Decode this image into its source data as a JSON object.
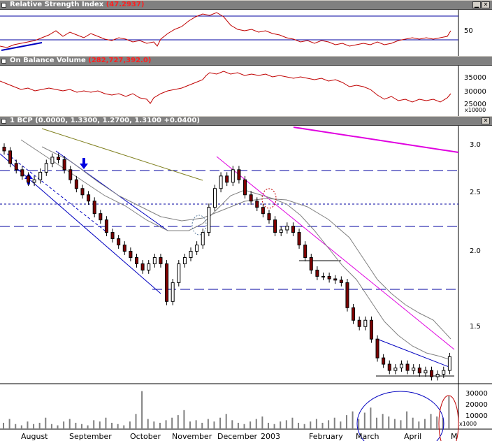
{
  "rsi": {
    "label": "Relative Strength Index",
    "value": "(47.2937)",
    "tick": "50"
  },
  "obv": {
    "label": "On Balance Volume",
    "value": "(282,727,392.0)",
    "ticks": [
      "35000",
      "30000",
      "25000"
    ],
    "mult": "x10000"
  },
  "price": {
    "label": "1 BCP",
    "value": "(0.0000, 1.3300, 1.2700, 1.3100 +0.0400)",
    "ticks": [
      "3.0",
      "2.5",
      "2.0",
      "1.5"
    ]
  },
  "volume": {
    "ticks": [
      "30000",
      "20000",
      "10000"
    ],
    "mult": "x1000"
  },
  "months": [
    "August",
    "September",
    "October",
    "November",
    "December",
    "2003",
    "February",
    "March",
    "April",
    "M"
  ],
  "colors": {
    "header": "#808080",
    "series": "#c00000",
    "trend": "#0000c0",
    "channel": "#e000e0",
    "grid": "#c0c0c0"
  },
  "icons": {
    "minimize": "minimize-icon",
    "close": "close-icon"
  },
  "chart_data": {
    "type": "candlestick",
    "title": "1 BCP",
    "x_range": [
      "2002-07-15",
      "2003-05-02"
    ],
    "price_ylim": [
      1.1,
      3.15
    ],
    "rsi_last": 47.2937,
    "obv_last": 282727392.0,
    "last_bar": {
      "open": 0.0,
      "high": 1.33,
      "low": 1.27,
      "close": 1.31,
      "change": 0.04
    },
    "close_series": [
      2.95,
      2.85,
      2.8,
      2.75,
      2.7,
      2.72,
      2.78,
      2.85,
      2.9,
      2.88,
      2.8,
      2.72,
      2.65,
      2.6,
      2.55,
      2.45,
      2.4,
      2.3,
      2.25,
      2.2,
      2.15,
      2.1,
      2.05,
      2.0,
      2.05,
      2.1,
      2.05,
      1.75,
      1.9,
      2.05,
      2.1,
      2.15,
      2.2,
      2.3,
      2.5,
      2.65,
      2.75,
      2.7,
      2.8,
      2.72,
      2.6,
      2.55,
      2.5,
      2.45,
      2.4,
      2.3,
      2.32,
      2.35,
      2.3,
      2.2,
      2.1,
      2.0,
      1.95,
      1.95,
      1.93,
      1.92,
      1.9,
      1.7,
      1.6,
      1.55,
      1.6,
      1.45,
      1.3,
      1.25,
      1.2,
      1.22,
      1.25,
      1.2,
      1.22,
      1.18,
      1.2,
      1.15,
      1.17,
      1.2,
      1.31
    ],
    "horizontal_levels": [
      2.7,
      2.4,
      2.2,
      1.72
    ],
    "volume_series": [
      5,
      8,
      4,
      3,
      6,
      4,
      5,
      9,
      4,
      3,
      6,
      8,
      5,
      4,
      3,
      7,
      6,
      9,
      5,
      4,
      3,
      6,
      12,
      30,
      8,
      6,
      5,
      7,
      9,
      11,
      15,
      6,
      7,
      5,
      8,
      6,
      9,
      12,
      7,
      5,
      4,
      6,
      8,
      10,
      5,
      4,
      6,
      7,
      9,
      5,
      4,
      6,
      8,
      5,
      7,
      9,
      6,
      11,
      14,
      8,
      13,
      17,
      9,
      12,
      10,
      8,
      7,
      14,
      9,
      6,
      8,
      12,
      10,
      9,
      26
    ]
  }
}
